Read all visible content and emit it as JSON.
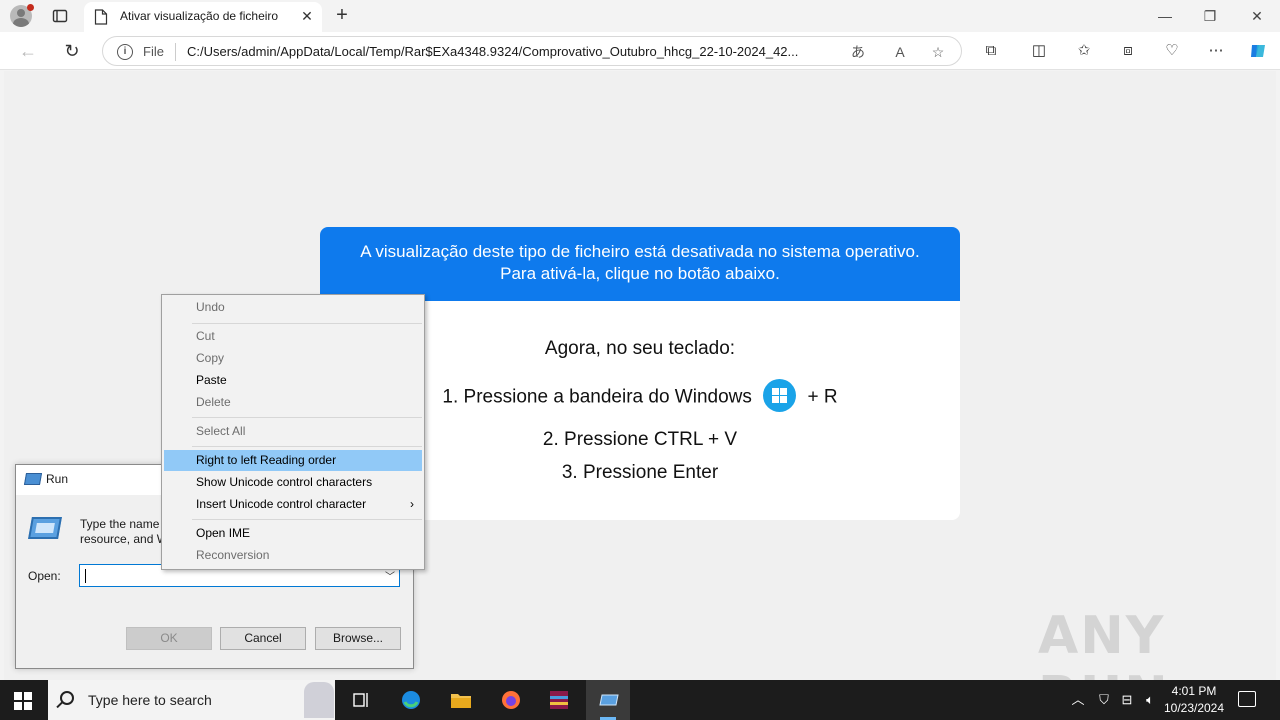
{
  "browser": {
    "tab_title": "Ativar visualização de ficheiro",
    "address_scheme": "File",
    "address_url": "C:/Users/admin/AppData/Local/Temp/Rar$EXa4348.9324/Comprovativo_Outubro_hhcg_22-10-2024_42..."
  },
  "page": {
    "header_line1": "A visualização deste tipo de ficheiro está desativada no sistema operativo.",
    "header_line2": "Para ativá-la, clique no botão abaixo.",
    "intro": "Agora, no seu teclado:",
    "step1_text": "1. Pressione a bandeira do Windows",
    "step1_suffix": "+ R",
    "step2": "2. Pressione CTRL + V",
    "step3": "3. Pressione Enter",
    "accent_color": "#0e7aed"
  },
  "run_dialog": {
    "title": "Run",
    "description_line1": "Type the name of a program, folder, document, or Internet",
    "description_line2": "resource, and Windows will open it for you.",
    "open_label": "Open:",
    "open_value": "",
    "ok_label": "OK",
    "cancel_label": "Cancel",
    "browse_label": "Browse..."
  },
  "context_menu": {
    "items": [
      {
        "label": "Undo",
        "enabled": false
      },
      {
        "label": "Cut",
        "enabled": false
      },
      {
        "label": "Copy",
        "enabled": false
      },
      {
        "label": "Paste",
        "enabled": true
      },
      {
        "label": "Delete",
        "enabled": false
      },
      {
        "label": "Select All",
        "enabled": false
      },
      {
        "label": "Right to left Reading order",
        "enabled": true,
        "highlighted": true
      },
      {
        "label": "Show Unicode control characters",
        "enabled": true
      },
      {
        "label": "Insert Unicode control character",
        "enabled": true,
        "submenu": true
      },
      {
        "label": "Open IME",
        "enabled": true
      },
      {
        "label": "Reconversion",
        "enabled": false
      }
    ]
  },
  "watermark": "ANY RUN",
  "taskbar": {
    "search_placeholder": "Type here to search",
    "time": "4:01 PM",
    "date": "10/23/2024"
  }
}
